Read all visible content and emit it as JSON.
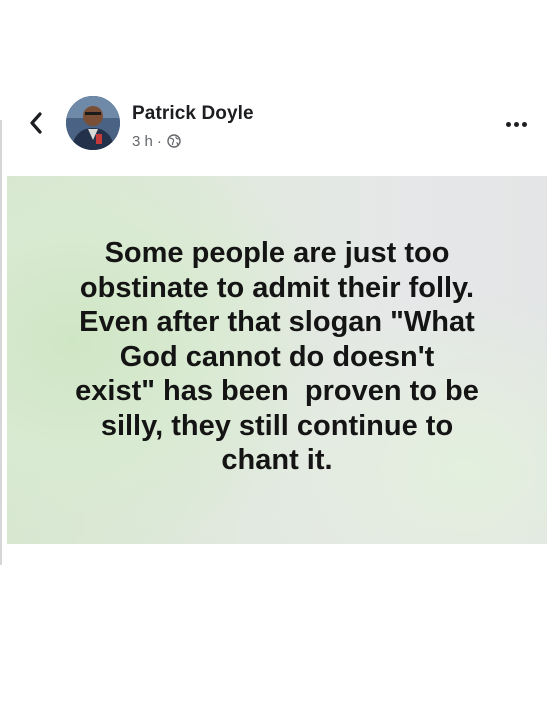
{
  "post": {
    "author": "Patrick Doyle",
    "time": "3 h",
    "separator": "·",
    "privacy_icon": "globe-icon",
    "text_lines": [
      "Some people are just too",
      "obstinate to admit their folly.",
      "Even after that slogan \"What",
      "God cannot do doesn't",
      "exist\" has been  proven to be",
      "silly, they still continue to",
      "chant it."
    ]
  },
  "header": {
    "back_icon": "chevron-left-icon",
    "more_icon": "more-options-icon"
  },
  "colors": {
    "text_primary": "#1c1e21",
    "text_secondary": "#65676b",
    "card_background": "#dfe9dc"
  }
}
